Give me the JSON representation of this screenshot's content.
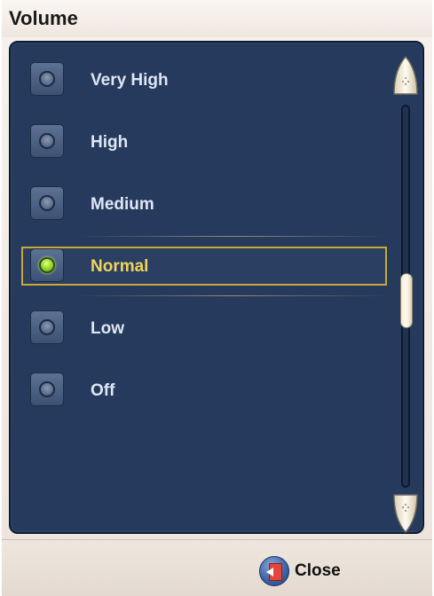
{
  "window": {
    "title": "Volume"
  },
  "options": [
    {
      "label": "Very High",
      "selected": false
    },
    {
      "label": "High",
      "selected": false
    },
    {
      "label": "Medium",
      "selected": false
    },
    {
      "label": "Normal",
      "selected": true
    },
    {
      "label": "Low",
      "selected": false
    },
    {
      "label": "Off",
      "selected": false
    }
  ],
  "colors": {
    "panel_bg": "#253a5c",
    "selected_border": "#c9a93a",
    "selected_text": "#f2d35b",
    "option_text": "#dfe6f3",
    "radio_on": "#a5e03a"
  },
  "icons": {
    "scroll_up": "chevron-up-icon",
    "scroll_down": "chevron-down-icon",
    "close": "exit-door-icon"
  },
  "footer": {
    "close_label": "Close"
  }
}
